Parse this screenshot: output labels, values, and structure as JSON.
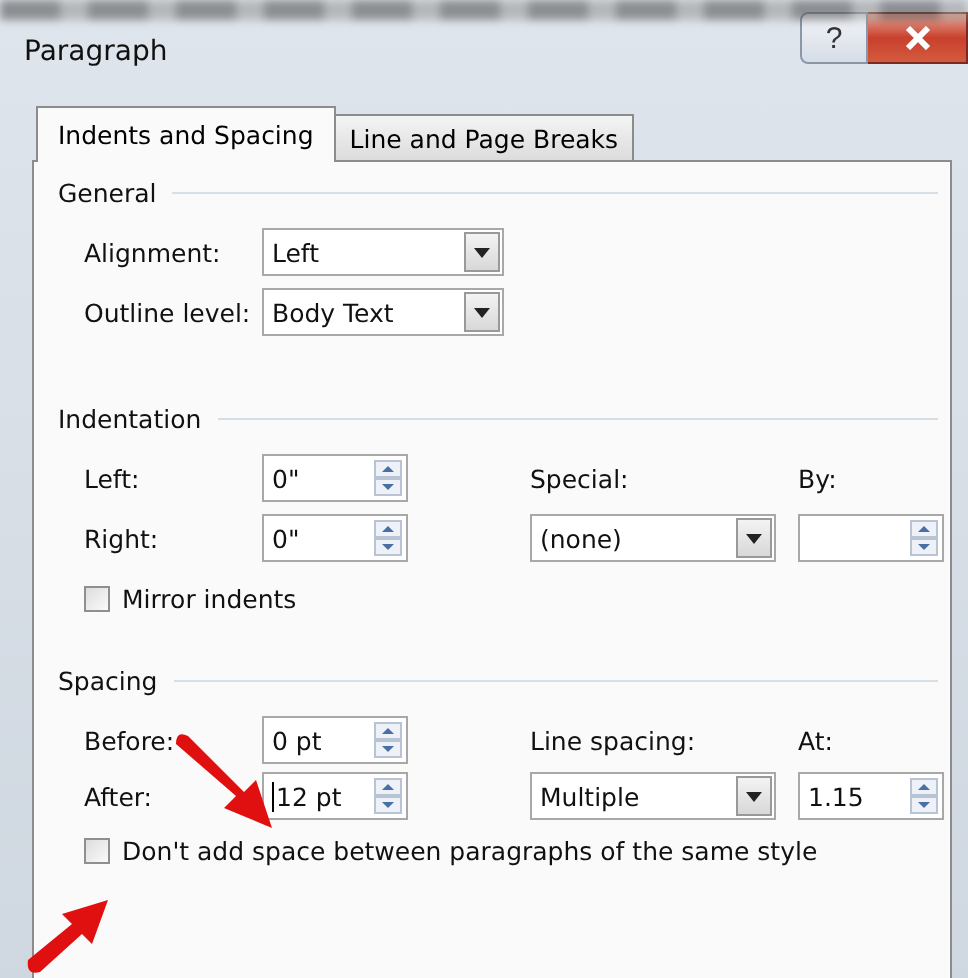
{
  "window": {
    "title": "Paragraph",
    "help_button": "?"
  },
  "tabs": [
    {
      "label": "Indents and Spacing",
      "selected": true
    },
    {
      "label": "Line and Page Breaks",
      "selected": false
    }
  ],
  "general": {
    "title": "General",
    "fields": [
      {
        "label": "Alignment:",
        "value": "Left"
      },
      {
        "label": "Outline level:",
        "value": "Body Text"
      }
    ]
  },
  "indentation": {
    "title": "Indentation",
    "left": {
      "label": "Left:",
      "value": "0\""
    },
    "right": {
      "label": "Right:",
      "value": "0\""
    },
    "special": {
      "label": "Special:",
      "value": "(none)"
    },
    "by": {
      "label": "By:"
    },
    "mirror_indents": {
      "label": "Mirror indents",
      "checked": false
    }
  },
  "spacing": {
    "title": "Spacing",
    "before": {
      "label": "Before:",
      "value": "0 pt",
      "focused": false
    },
    "after": {
      "label": "After:",
      "value": "12 pt",
      "focused": true
    },
    "line_spacing": {
      "label": "Line spacing:",
      "value": "Multiple"
    },
    "at": {
      "label": "At:",
      "value": "1.15",
      "focused": false
    },
    "dont_add_space": {
      "label": "Don't add space between paragraphs of the same style",
      "checked": false
    }
  }
}
